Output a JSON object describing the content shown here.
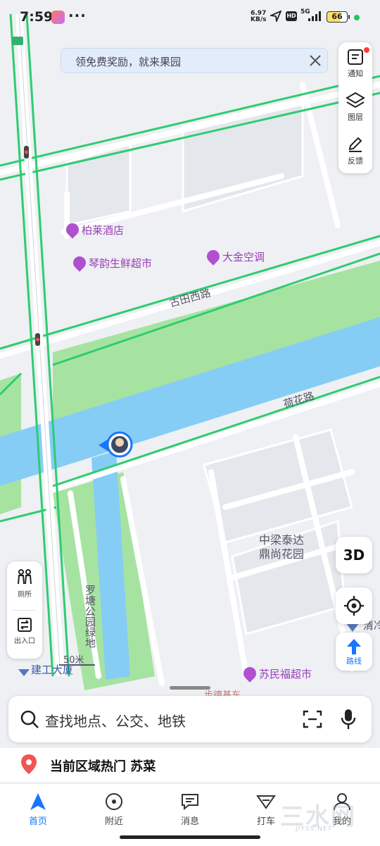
{
  "status_bar": {
    "time": "7:59",
    "more": "···",
    "net_speed_value": "6.97",
    "net_speed_unit": "KB/s",
    "hd": "HD",
    "network": "5G",
    "battery": "66"
  },
  "banner": {
    "text": "领免费奖励，就来果园"
  },
  "right_panel": {
    "notify": "通知",
    "layers": "图层",
    "feedback": "反馈"
  },
  "left_panel": {
    "toilet": "厕所",
    "entrance": "出入口"
  },
  "buttons": {
    "three_d": "3D",
    "route": "路线"
  },
  "map": {
    "pois": {
      "hotel": "柏莱酒店",
      "supermarket": "琴韵生鲜超市",
      "aircon": "大金空调",
      "sumin": "苏民福超市"
    },
    "roads": {
      "gutian": "古田西路",
      "hehua": "荷花路"
    },
    "labels": {
      "community": "中梁泰达\n鼎尚花园",
      "park": "罗塘公园绿地",
      "building": "建工大厦",
      "distance": "50米",
      "partial_right": "清冷",
      "partial_bottom": "步德基东"
    }
  },
  "search": {
    "placeholder": "查找地点、公交、地铁"
  },
  "hot": {
    "text": "当前区域热门 苏菜"
  },
  "tabs": [
    {
      "label": "首页"
    },
    {
      "label": "附近"
    },
    {
      "label": "消息"
    },
    {
      "label": "打车"
    },
    {
      "label": "我的"
    }
  ],
  "watermark": {
    "text": "三水网",
    "url": "JIYSS.NET"
  },
  "colors": {
    "accent": "#1677ff",
    "road_outline": "#2ecc71",
    "river": "#86cdf5",
    "park": "#a6e3a1",
    "poi": "#b04fd0"
  }
}
